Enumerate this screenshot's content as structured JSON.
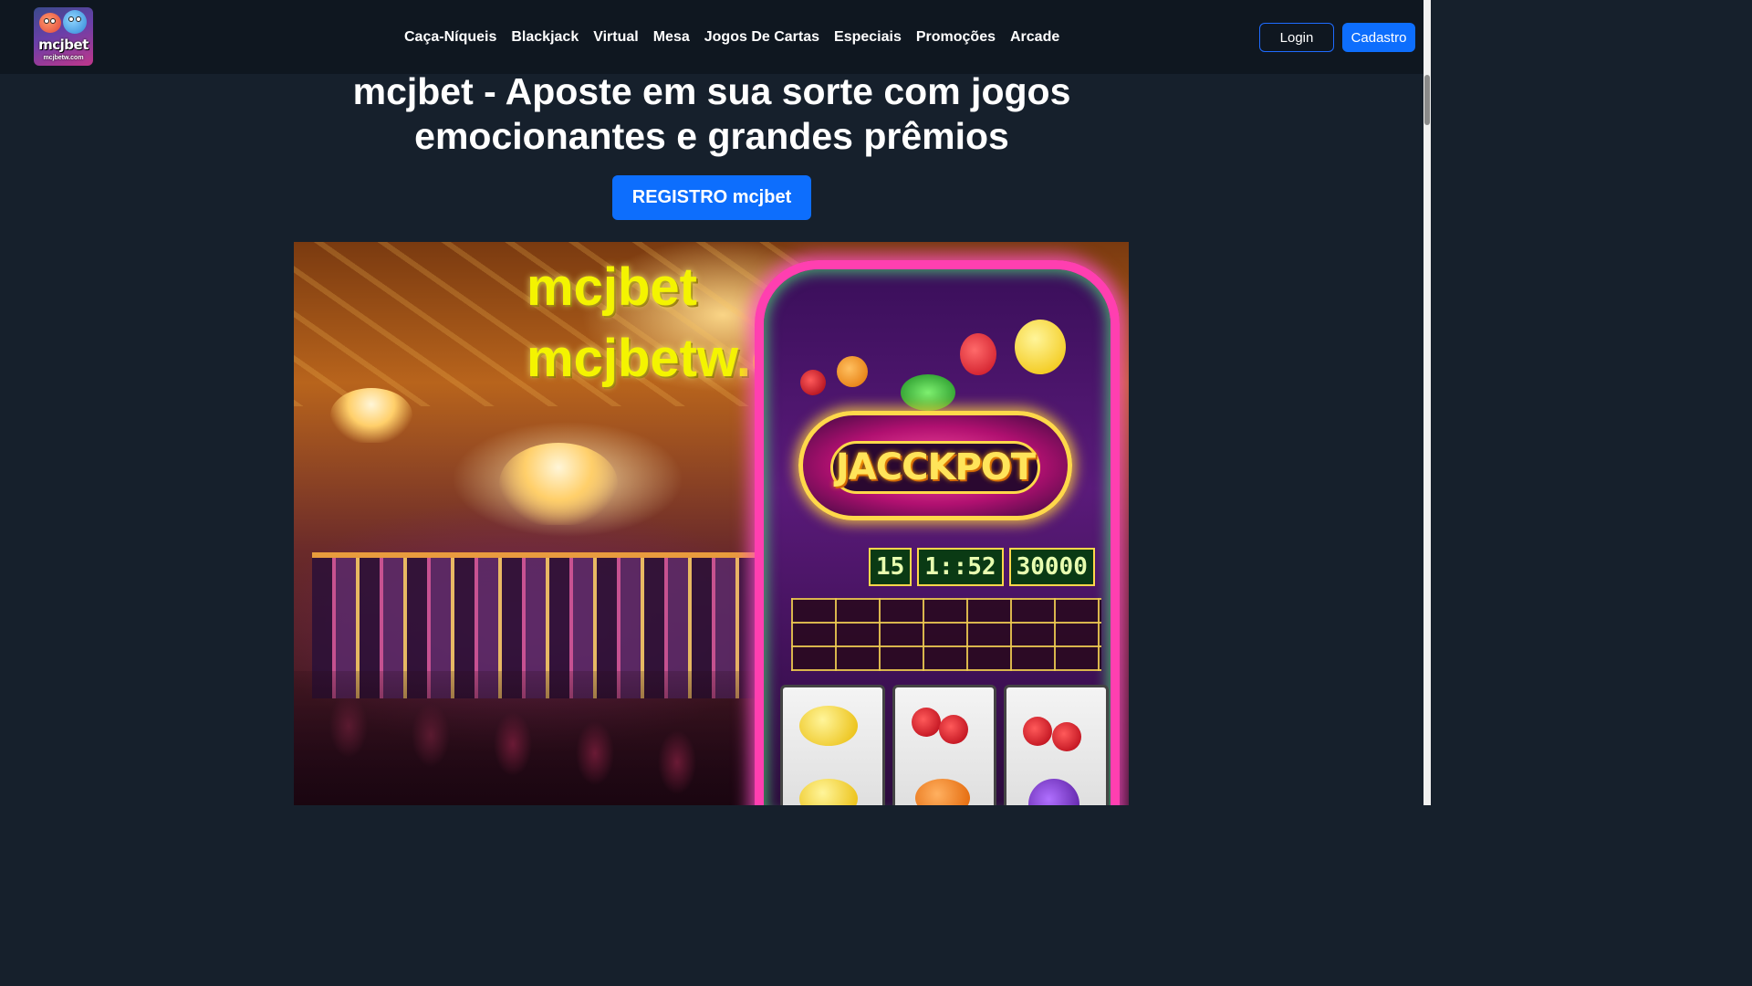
{
  "brand": {
    "logo_text": "mcjbet",
    "logo_subtext": "mcjbetw.com"
  },
  "nav": {
    "items": [
      {
        "label": "Caça-Níqueis"
      },
      {
        "label": "Blackjack"
      },
      {
        "label": "Virtual"
      },
      {
        "label": "Mesa"
      },
      {
        "label": "Jogos De Cartas"
      },
      {
        "label": "Especiais"
      },
      {
        "label": "Promoções"
      },
      {
        "label": "Arcade"
      }
    ],
    "login_label": "Login",
    "signup_label": "Cadastro"
  },
  "hero": {
    "title": "mcjbet - Aposte em sua sorte com jogos emocionantes e grandes prêmios",
    "register_label": "REGISTRO mcjbet"
  },
  "banner": {
    "line1": "mcjbet",
    "line2": "mcjbetw.com",
    "jackpot_label": "JACCKPOT",
    "display_values": [
      "15",
      "1::52",
      "30000"
    ]
  },
  "colors": {
    "page_bg": "#16202c",
    "navbar_bg": "#0f1720",
    "primary": "#0d6efd",
    "banner_text": "#f4f400"
  }
}
